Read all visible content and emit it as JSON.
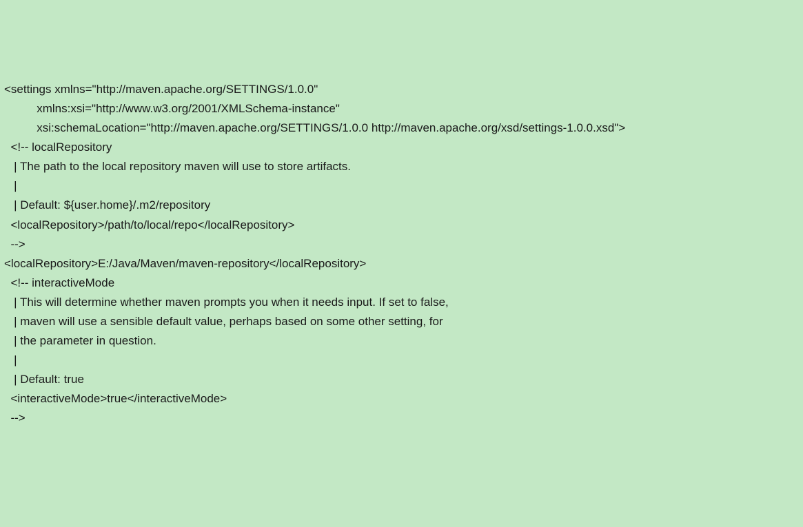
{
  "lines": [
    "<settings xmlns=\"http://maven.apache.org/SETTINGS/1.0.0\"",
    "          xmlns:xsi=\"http://www.w3.org/2001/XMLSchema-instance\"",
    "          xsi:schemaLocation=\"http://maven.apache.org/SETTINGS/1.0.0 http://maven.apache.org/xsd/settings-1.0.0.xsd\">",
    "  <!-- localRepository",
    "   | The path to the local repository maven will use to store artifacts.",
    "   |",
    "   | Default: ${user.home}/.m2/repository",
    "  <localRepository>/path/to/local/repo</localRepository>",
    "  -->",
    "<localRepository>E:/Java/Maven/maven-repository</localRepository>",
    "  <!-- interactiveMode",
    "   | This will determine whether maven prompts you when it needs input. If set to false,",
    "   | maven will use a sensible default value, perhaps based on some other setting, for",
    "   | the parameter in question.",
    "   |",
    "   | Default: true",
    "  <interactiveMode>true</interactiveMode>",
    "  -->"
  ]
}
